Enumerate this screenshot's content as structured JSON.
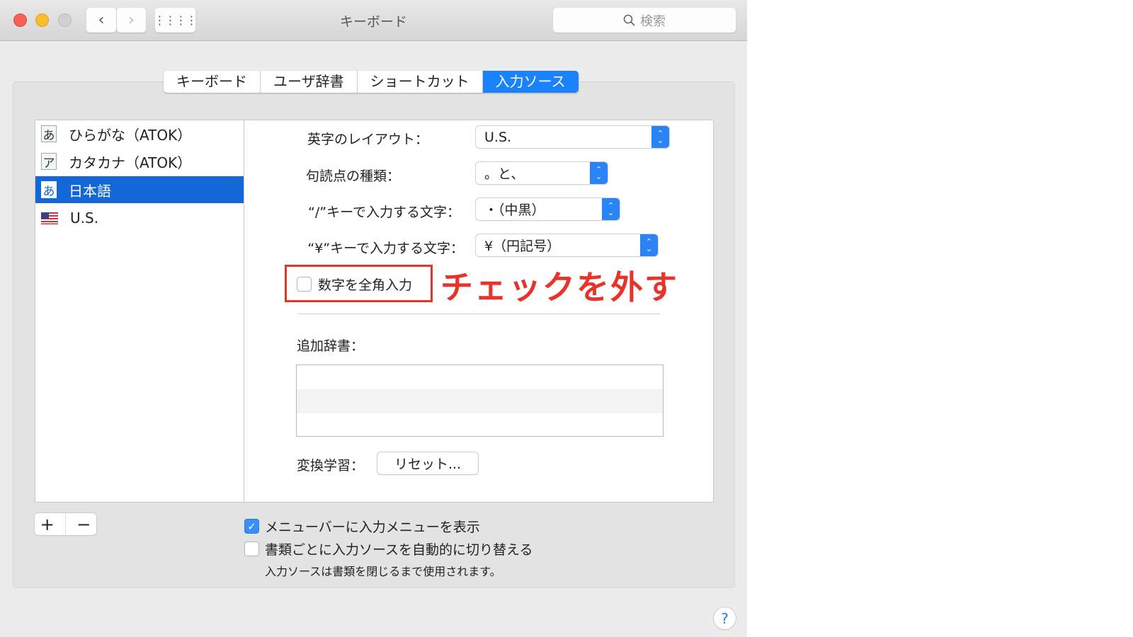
{
  "window": {
    "title": "キーボード",
    "search_placeholder": "検索"
  },
  "tabs": [
    {
      "label": "キーボード"
    },
    {
      "label": "ユーザ辞書"
    },
    {
      "label": "ショートカット"
    },
    {
      "label": "入力ソース",
      "active": true
    }
  ],
  "sources": [
    {
      "icon": "あ",
      "label": "ひらがな（ATOK）"
    },
    {
      "icon": "ア",
      "label": "カタカナ（ATOK）"
    },
    {
      "icon": "あ",
      "label": "日本語",
      "selected": true
    },
    {
      "icon": "us-flag",
      "label": "U.S."
    }
  ],
  "settings": {
    "layout": {
      "label": "英字のレイアウト：",
      "value": "U.S."
    },
    "punct": {
      "label": "句読点の種類：",
      "value": "。と、"
    },
    "slash": {
      "label": "“/”キーで入力する文字：",
      "value": "・（中黒）"
    },
    "yen": {
      "label": "“¥”キーで入力する文字：",
      "value": "¥（円記号）"
    },
    "fullwidth_numbers": {
      "label": "数字を全角入力",
      "checked": false
    },
    "dict_label": "追加辞書：",
    "learning_label": "変換学習：",
    "reset_label": "リセット..."
  },
  "annotation": "チェックを外す",
  "bottom": {
    "add": "+",
    "remove": "−",
    "show_menu": {
      "label": "メニューバーに入力メニューを表示",
      "checked": true
    },
    "auto_switch": {
      "label": "書類ごとに入力ソースを自動的に切り替える",
      "checked": false
    },
    "note": "入力ソースは書類を閉じるまで使用されます。",
    "help": "?"
  },
  "colors": {
    "accent": "#1a82fb",
    "selection": "#1467d6",
    "annotation": "#e8332a"
  }
}
